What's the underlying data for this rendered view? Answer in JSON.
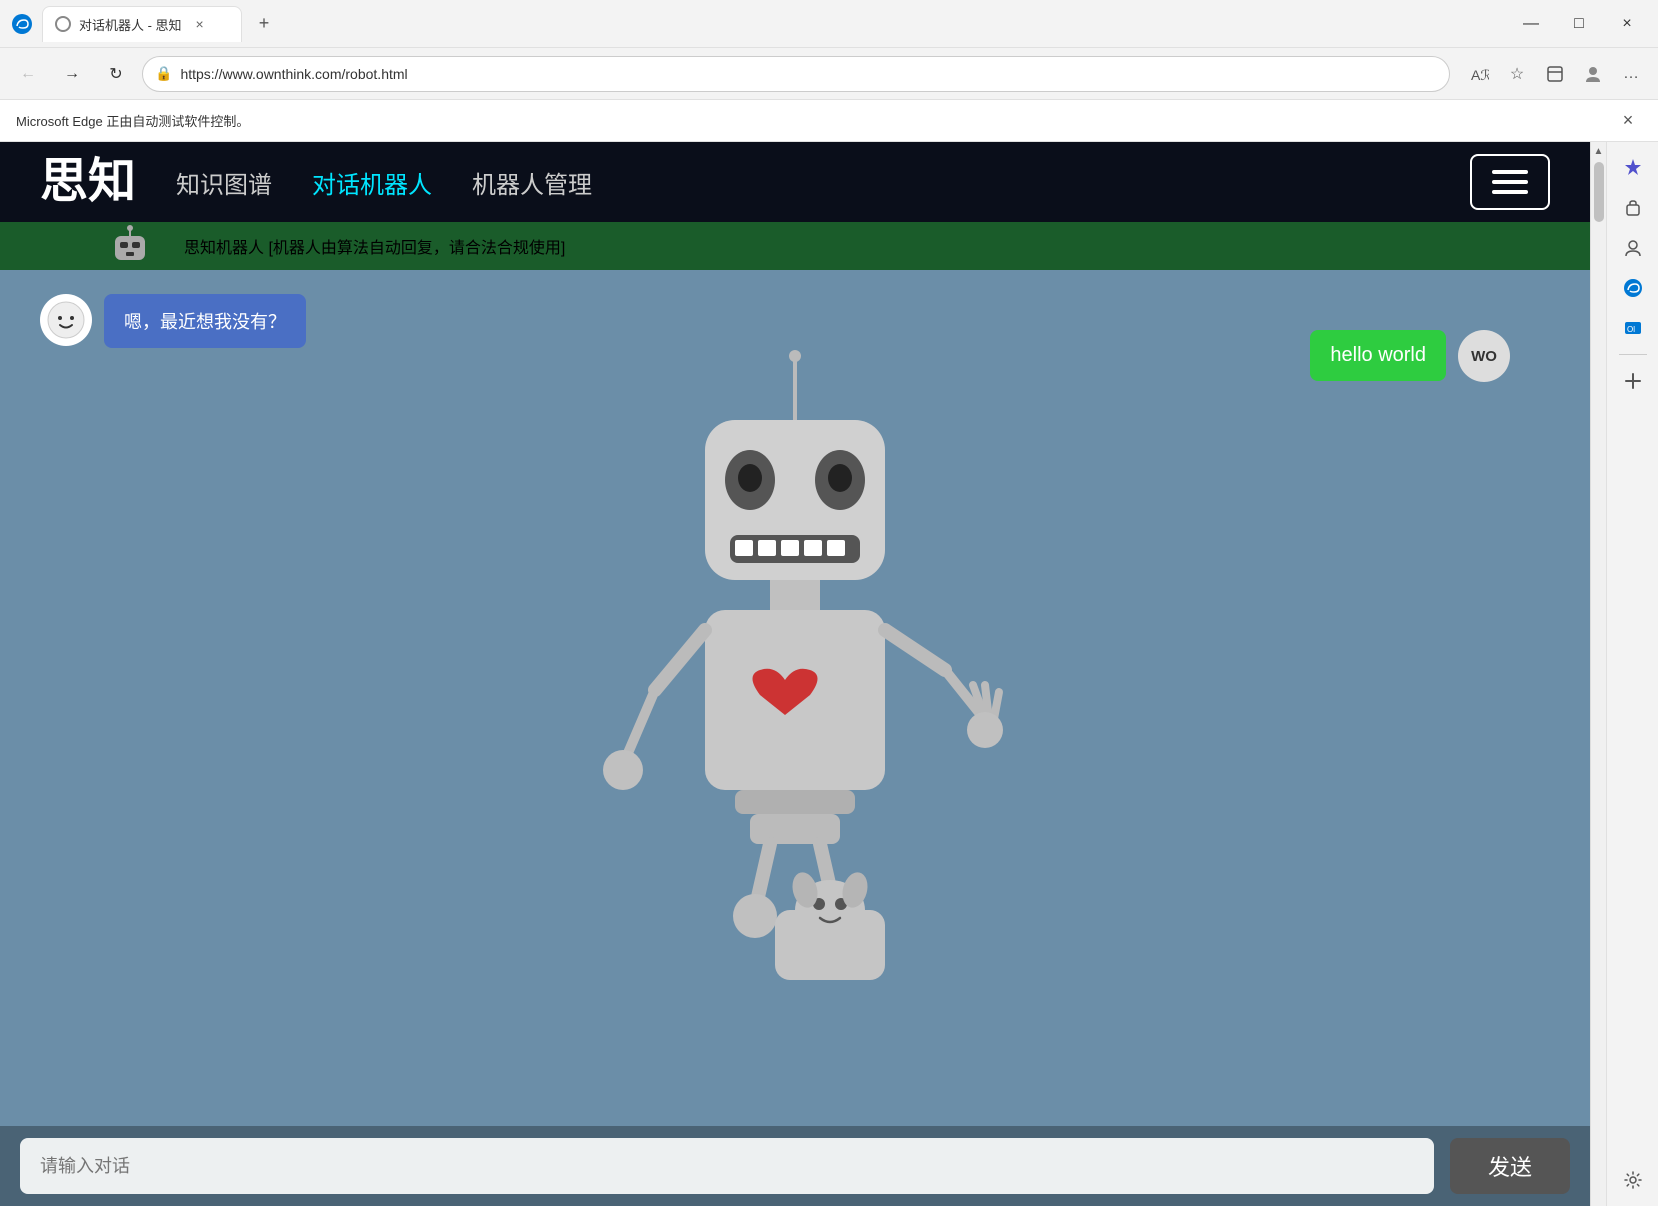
{
  "browser": {
    "tab_title": "对话机器人 - 思知",
    "url": "https://www.ownthink.com/robot.html",
    "automation_notice": "Microsoft Edge 正由自动测试软件控制。",
    "close_label": "×",
    "minimize_label": "—",
    "maximize_label": "□",
    "new_tab_label": "+",
    "back_icon": "←",
    "forward_icon": "→",
    "refresh_icon": "↻",
    "lock_icon": "🔒"
  },
  "site": {
    "logo": "思知",
    "nav_items": [
      {
        "label": "知识图谱",
        "active": false
      },
      {
        "label": "对话机器人",
        "active": true
      },
      {
        "label": "机器人管理",
        "active": false
      }
    ],
    "sub_header_text": "思知机器人 [机器人由算法自动回复，请合法合规使用]"
  },
  "chat": {
    "bot_avatar_symbol": "😊",
    "bot_message": "嗯，最近想我没有？",
    "user_message": "hello world",
    "user_avatar_text": "WO",
    "input_placeholder": "请输入对话",
    "send_button_label": "发送"
  },
  "right_sidebar": {
    "icons": [
      "✦",
      "🎒",
      "👤",
      "🌐",
      "📋",
      "+",
      "⚙"
    ]
  }
}
